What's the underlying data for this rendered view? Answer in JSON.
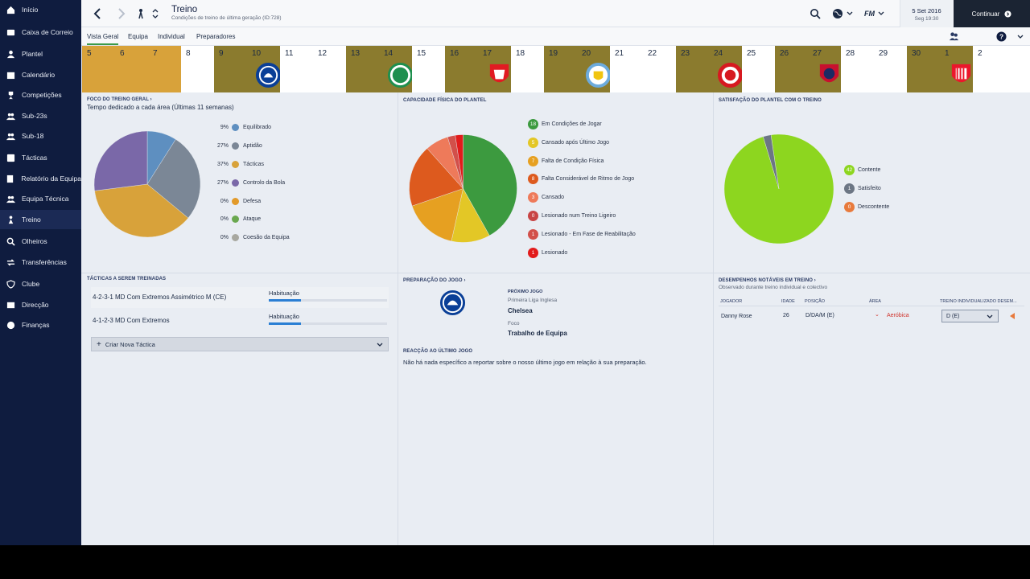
{
  "sidebar": {
    "items": [
      {
        "label": "Início",
        "icon": "home-icon"
      },
      {
        "label": "Caixa de Correio",
        "icon": "inbox-icon"
      },
      {
        "label": "Plantel",
        "icon": "squad-icon"
      },
      {
        "label": "Calendário",
        "icon": "calendar-icon"
      },
      {
        "label": "Competições",
        "icon": "trophy-icon"
      },
      {
        "label": "Sub-23s",
        "icon": "group-icon"
      },
      {
        "label": "Sub-18",
        "icon": "group-icon"
      },
      {
        "label": "Tácticas",
        "icon": "tactics-icon"
      },
      {
        "label": "Relatório da Equipa",
        "icon": "report-icon"
      },
      {
        "label": "Equipa Técnica",
        "icon": "staff-icon"
      },
      {
        "label": "Treino",
        "icon": "training-icon"
      },
      {
        "label": "Olheiros",
        "icon": "scout-icon"
      },
      {
        "label": "Transferências",
        "icon": "transfer-icon"
      },
      {
        "label": "Clube",
        "icon": "shield-icon"
      },
      {
        "label": "Direcção",
        "icon": "board-icon"
      },
      {
        "label": "Finanças",
        "icon": "finance-icon"
      }
    ]
  },
  "header": {
    "title": "Treino",
    "subtitle": "Condições de treino de última geração (ID:728)",
    "date": "5 Set 2016",
    "time": "Seg 19:30",
    "continue_label": "Continuar",
    "game_logo": "FM"
  },
  "tabs": [
    {
      "label": "Vista Geral",
      "active": true
    },
    {
      "label": "Equipa",
      "active": false
    },
    {
      "label": "Individual",
      "active": false
    },
    {
      "label": "Preparadores",
      "active": false
    }
  ],
  "calendar": {
    "days": [
      {
        "n": "5",
        "type": "training",
        "color": "#d8a23a"
      },
      {
        "n": "6",
        "type": "training",
        "color": "#d8a23a"
      },
      {
        "n": "7",
        "type": "training",
        "color": "#d8a23a"
      },
      {
        "n": "8",
        "type": "rest",
        "color": "#ffffff"
      },
      {
        "n": "9",
        "type": "match-prep",
        "color": "#8b7b2e"
      },
      {
        "n": "10",
        "type": "match",
        "color": "#8b7b2e",
        "crest": "chelsea-crest"
      },
      {
        "n": "11",
        "type": "rest",
        "color": "#ffffff"
      },
      {
        "n": "12",
        "type": "rest",
        "color": "#ffffff"
      },
      {
        "n": "13",
        "type": "match-prep",
        "color": "#8b7b2e"
      },
      {
        "n": "14",
        "type": "match",
        "color": "#8b7b2e",
        "crest": "celtic-crest"
      },
      {
        "n": "15",
        "type": "rest",
        "color": "#ffffff"
      },
      {
        "n": "16",
        "type": "match-prep",
        "color": "#8b7b2e"
      },
      {
        "n": "17",
        "type": "match",
        "color": "#8b7b2e",
        "crest": "middlesbrough-crest"
      },
      {
        "n": "18",
        "type": "rest",
        "color": "#ffffff"
      },
      {
        "n": "19",
        "type": "match-prep",
        "color": "#8b7b2e"
      },
      {
        "n": "20",
        "type": "match",
        "color": "#8b7b2e",
        "crest": "man-city-crest"
      },
      {
        "n": "21",
        "type": "rest",
        "color": "#ffffff"
      },
      {
        "n": "22",
        "type": "rest",
        "color": "#ffffff"
      },
      {
        "n": "23",
        "type": "match-prep",
        "color": "#8b7b2e"
      },
      {
        "n": "24",
        "type": "match",
        "color": "#8b7b2e",
        "crest": "southampton-crest"
      },
      {
        "n": "25",
        "type": "rest",
        "color": "#ffffff"
      },
      {
        "n": "26",
        "type": "match-prep",
        "color": "#8b7b2e"
      },
      {
        "n": "27",
        "type": "match",
        "color": "#8b7b2e",
        "crest": "cska-crest"
      },
      {
        "n": "28",
        "type": "rest",
        "color": "#ffffff"
      },
      {
        "n": "29",
        "type": "rest",
        "color": "#ffffff"
      },
      {
        "n": "30",
        "type": "match-prep",
        "color": "#8b7b2e"
      },
      {
        "n": "1",
        "type": "match",
        "color": "#8b7b2e",
        "crest": "sunderland-crest"
      },
      {
        "n": "2",
        "type": "rest",
        "color": "#ffffff"
      }
    ]
  },
  "focus": {
    "title": "FOCO DO TREINO GERAL",
    "subtitle": "Tempo dedicado a cada área (Últimas 11 semanas)",
    "items": [
      {
        "pct": "9%",
        "value": 9,
        "label": "Equilibrado",
        "color": "#5e8fc0"
      },
      {
        "pct": "27%",
        "value": 27,
        "label": "Aptidão",
        "color": "#7b8796"
      },
      {
        "pct": "37%",
        "value": 37,
        "label": "Tácticas",
        "color": "#d8a23a"
      },
      {
        "pct": "27%",
        "value": 27,
        "label": "Controlo da Bola",
        "color": "#7a68a8"
      },
      {
        "pct": "0%",
        "value": 0,
        "label": "Defesa",
        "color": "#e29a2a"
      },
      {
        "pct": "0%",
        "value": 0,
        "label": "Ataque",
        "color": "#6aa84f"
      },
      {
        "pct": "0%",
        "value": 0,
        "label": "Coesão da Equipa",
        "color": "#a8a8a0"
      }
    ]
  },
  "fitness": {
    "title": "CAPACIDADE FÍSICA DO PLANTEL",
    "items": [
      {
        "count": "18",
        "value": 18,
        "label": "Em Condições de Jogar",
        "color": "#3c9a3f"
      },
      {
        "count": "5",
        "value": 5,
        "label": "Cansado após Último Jogo",
        "color": "#e3c726"
      },
      {
        "count": "7",
        "value": 7,
        "label": "Falta de Condição Física",
        "color": "#e6a021"
      },
      {
        "count": "8",
        "value": 8,
        "label": "Falta Considerável de Ritmo de Jogo",
        "color": "#dd5a1e"
      },
      {
        "count": "3",
        "value": 3,
        "label": "Cansado",
        "color": "#ee7a5a"
      },
      {
        "count": "0",
        "value": 0,
        "label": "Lesionado num Treino Ligeiro",
        "color": "#c84545"
      },
      {
        "count": "1",
        "value": 1,
        "label": "Lesionado - Em Fase de Reabilitação",
        "color": "#d2504a"
      },
      {
        "count": "1",
        "value": 1,
        "label": "Lesionado",
        "color": "#e21b1b"
      }
    ]
  },
  "satisfaction": {
    "title": "SATISFAÇÃO DO PLANTEL COM O TREINO",
    "items": [
      {
        "count": "42",
        "value": 42,
        "label": "Contente",
        "color": "#8dd61f"
      },
      {
        "count": "1",
        "value": 1,
        "label": "Satisfeito",
        "color": "#6c7684"
      },
      {
        "count": "0",
        "value": 0,
        "label": "Descontente",
        "color": "#e87a3c"
      }
    ]
  },
  "tactics": {
    "title": "TÁCTICAS A SEREM TREINADAS",
    "rows": [
      {
        "name": "4-2-3-1 MD Com Extremos Assimétrico M (CE)",
        "level": "Habituação",
        "progress": 0.27
      },
      {
        "name": "4-1-2-3 MD Com Extremos",
        "level": "Habituação",
        "progress": 0.27
      }
    ],
    "new_label": "Criar Nova Táctica"
  },
  "match_prep": {
    "title": "PREPARAÇÃO DO JOGO",
    "next_label": "PRÓXIMO JOGO",
    "competition": "Primeira Liga Inglesa",
    "opponent": "Chelsea",
    "focus_label": "Foco",
    "focus_value": "Trabalho de Equipa",
    "reaction_title": "REACÇÃO AO ÚLTIMO JOGO",
    "reaction_text": "Não há nada específico a reportar sobre o nosso último jogo em relação à sua preparação."
  },
  "performances": {
    "title": "DESEMPENHOS NOTÁVEIS EM TREINO",
    "subtitle": "Observado durante treino individual e colectivo",
    "headers": [
      "JOGADOR",
      "IDADE",
      "POSIÇÃO",
      "ÁREA",
      "TREINO INDIVIDUALIZADO DESEM..."
    ],
    "rows": [
      {
        "player": "Danny Rose",
        "age": "26",
        "position": "D/DA/M (E)",
        "area": "Aeróbica",
        "individual": "D (E)"
      }
    ]
  }
}
